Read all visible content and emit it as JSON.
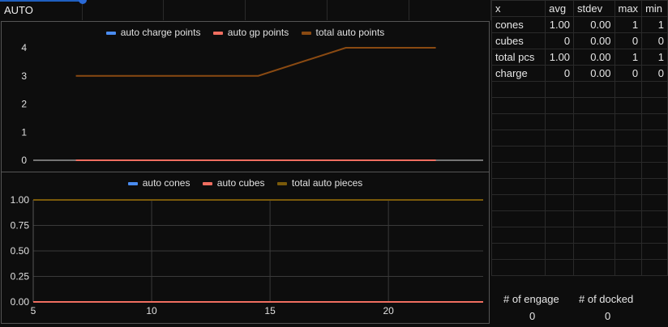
{
  "header": {
    "title": "AUTO"
  },
  "colors": {
    "blue": "#4a8cf0",
    "red": "#f06e60",
    "brown": "#8a4a12",
    "olive": "#7a5a0a"
  },
  "chart_top": {
    "legend": [
      "auto charge points",
      "auto gp points",
      "total auto points"
    ],
    "chart_data": {
      "type": "line",
      "x": [
        6.8,
        14.5,
        18.2,
        22.0
      ],
      "xlim": [
        5,
        24
      ],
      "ylim": [
        0,
        4
      ],
      "yticks": [
        "0",
        "1",
        "2",
        "3",
        "4"
      ],
      "series": [
        {
          "name": "auto charge points",
          "color": "#4a8cf0",
          "values": [
            0,
            0,
            0,
            0
          ]
        },
        {
          "name": "auto gp points",
          "color": "#f06e60",
          "values": [
            0,
            0,
            0,
            0
          ]
        },
        {
          "name": "total auto points",
          "color": "#8a4a12",
          "values": [
            3,
            3,
            4,
            4
          ]
        }
      ]
    }
  },
  "chart_bottom": {
    "legend": [
      "auto cones",
      "auto cubes",
      "total auto pieces"
    ],
    "chart_data": {
      "type": "line",
      "x": [
        5,
        24
      ],
      "xlim": [
        5,
        24
      ],
      "ylim": [
        0,
        1
      ],
      "yticks": [
        "0.00",
        "0.25",
        "0.50",
        "0.75",
        "1.00"
      ],
      "xticks": [
        "5",
        "10",
        "15",
        "20"
      ],
      "series": [
        {
          "name": "auto cones",
          "color": "#4a8cf0",
          "values": [
            1,
            1
          ]
        },
        {
          "name": "auto cubes",
          "color": "#f06e60",
          "values": [
            0,
            0
          ]
        },
        {
          "name": "total auto pieces",
          "color": "#7a5a0a",
          "values": [
            1,
            1
          ]
        }
      ]
    }
  },
  "stats": {
    "columns": [
      "x",
      "avg",
      "stdev",
      "max",
      "min"
    ],
    "rows": [
      [
        "cones",
        "1.00",
        "0.00",
        "1",
        "1"
      ],
      [
        "cubes",
        "0",
        "0.00",
        "0",
        "0"
      ],
      [
        "total pcs",
        "1.00",
        "0.00",
        "1",
        "1"
      ],
      [
        "charge",
        "0",
        "0.00",
        "0",
        "0"
      ]
    ]
  },
  "engage": {
    "label": "# of engage",
    "value": "0"
  },
  "docked": {
    "label": "# of docked",
    "value": "0"
  }
}
